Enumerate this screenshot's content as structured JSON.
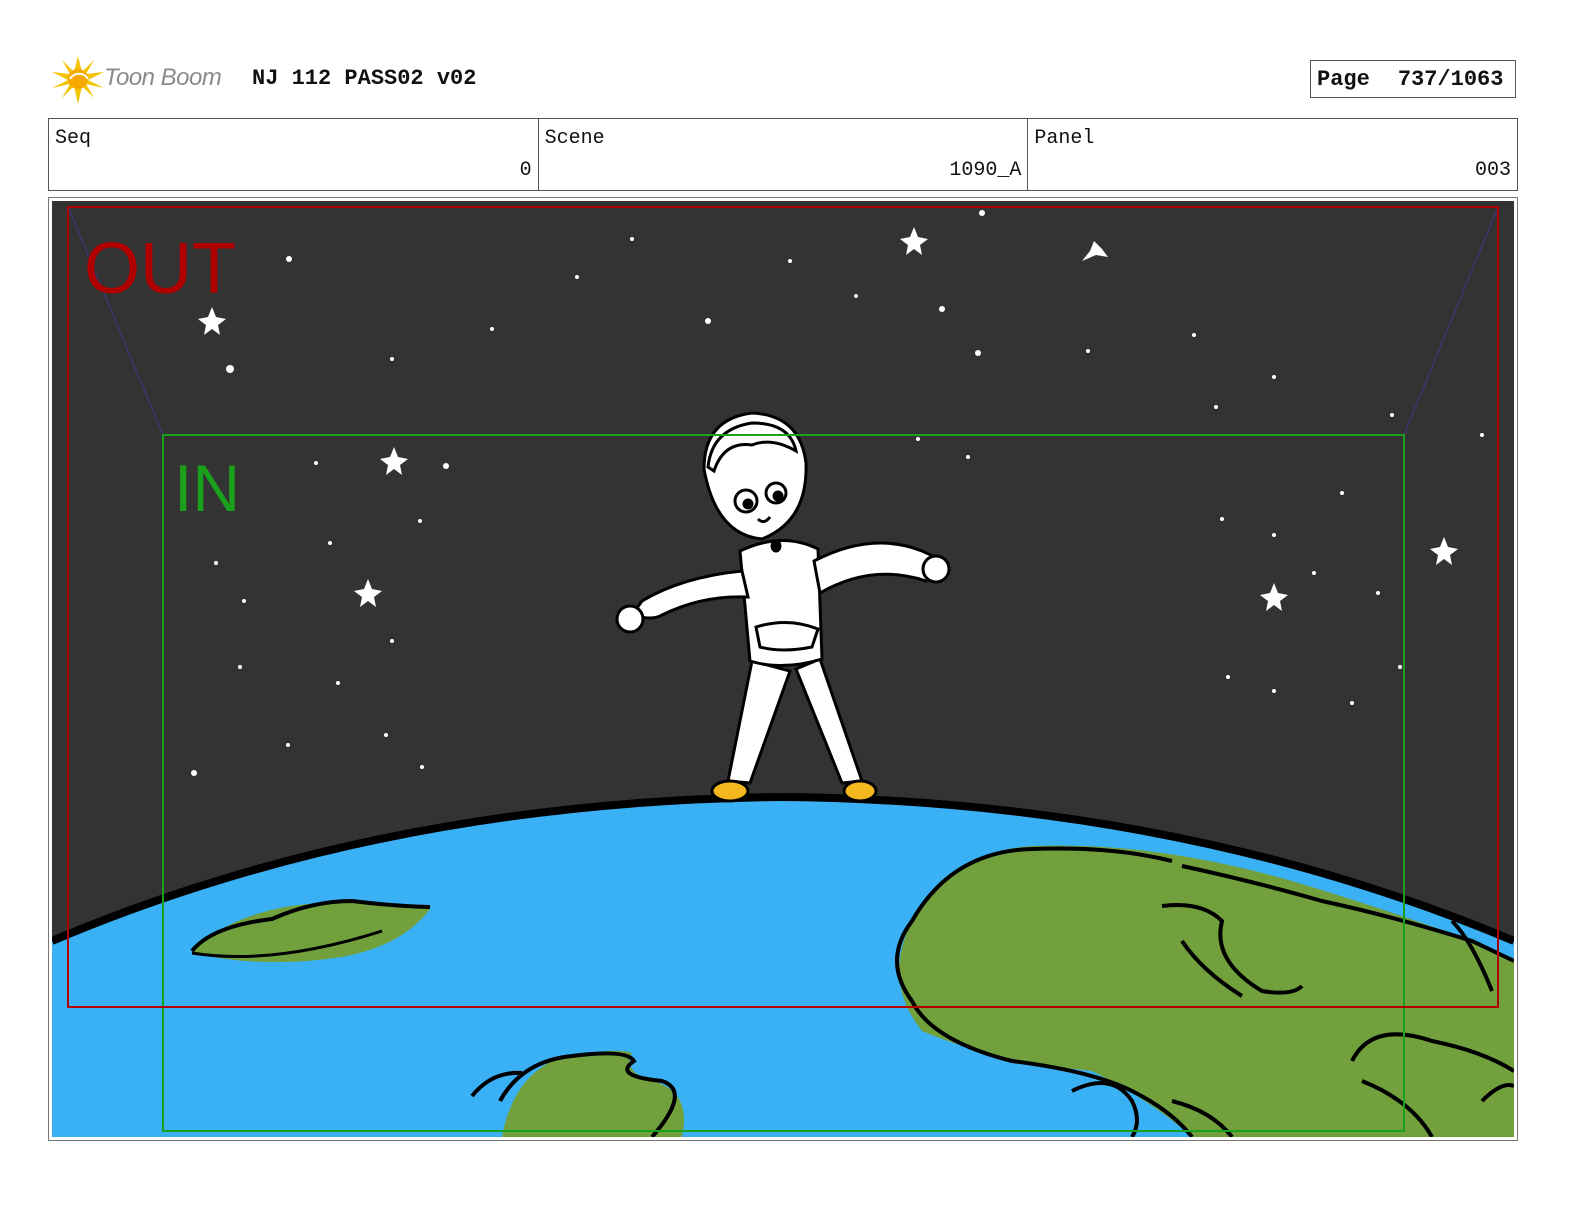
{
  "header": {
    "logo_text": "Toon Boom",
    "title": "NJ 112 PASS02 v02",
    "page_label": "Page",
    "page_value": "737/1063"
  },
  "info": {
    "seq_label": "Seq",
    "seq_value": "0",
    "scene_label": "Scene",
    "scene_value": "1090_A",
    "panel_label": "Panel",
    "panel_value": "003"
  },
  "frame": {
    "out_label": "OUT",
    "in_label": "IN",
    "colors": {
      "out": "#b00000",
      "in": "#1aa01a",
      "sky": "#333333",
      "ocean": "#3ab0f5",
      "land": "#72a03c",
      "shoes": "#f2b81e"
    }
  }
}
